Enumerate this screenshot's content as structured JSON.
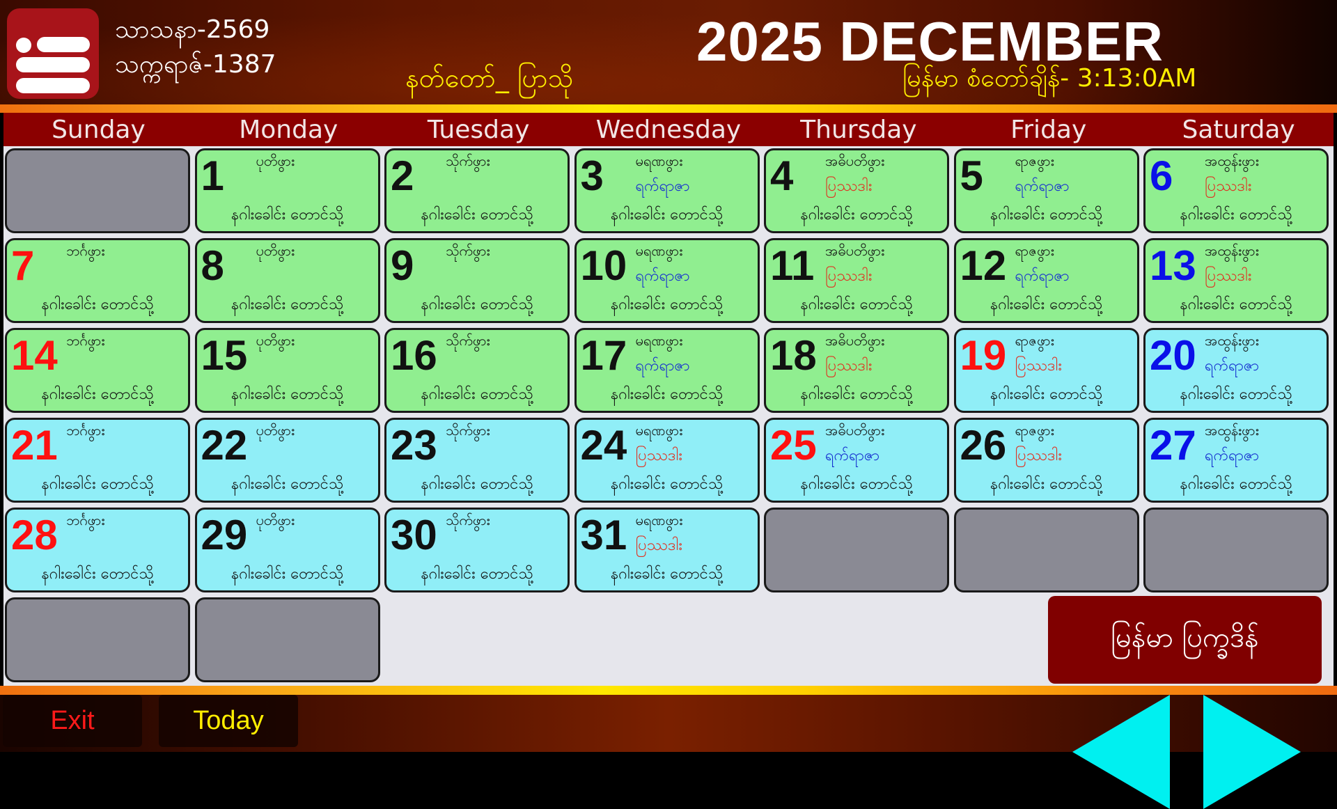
{
  "header": {
    "menu_icon": "menu-list-icon",
    "buddhist_era": "သာသနာ-2569",
    "myanmar_era": "သက္ကရာဇ်-1387",
    "astrological_direction": "နတ်တော်_ ပြာသို",
    "title": "2025 DECEMBER",
    "myanmar_time": "မြန်မာ စံတော်ချိန်- 3:13:0AM"
  },
  "weekdays": [
    "Sunday",
    "Monday",
    "Tuesday",
    "Wednesday",
    "Thursday",
    "Friday",
    "Saturday"
  ],
  "colors": {
    "accent": "#8b0000",
    "cell_green": "#90ee90",
    "cell_cyan": "#90eef7",
    "cell_empty": "#8a8a94",
    "num_black": "#111111",
    "num_red": "#ff1010",
    "num_blue": "#0a10e8",
    "note_blue": "#1530d0",
    "note_red": "#e03020",
    "arrow": "#00f0f0"
  },
  "calendar": {
    "leading_empty": 1,
    "trailing_empty": 5,
    "moon_text": "နဂါးခေါင်း တောင်သို့",
    "days": [
      {
        "day": "1",
        "star": "ပုတိဖွား",
        "note": "",
        "note_color": "",
        "num_color": "black",
        "bg": "green"
      },
      {
        "day": "2",
        "star": "သိုက်ဖွား",
        "note": "",
        "note_color": "",
        "num_color": "black",
        "bg": "green"
      },
      {
        "day": "3",
        "star": "မရဏဖွား",
        "note": "ရက်ရာဇာ",
        "note_color": "blue",
        "num_color": "black",
        "bg": "green"
      },
      {
        "day": "4",
        "star": "အဓိပတိဖွား",
        "note": "ပြဿဒါး",
        "note_color": "red",
        "num_color": "black",
        "bg": "green"
      },
      {
        "day": "5",
        "star": "ရာဇဖွား",
        "note": "ရက်ရာဇာ",
        "note_color": "blue",
        "num_color": "black",
        "bg": "green"
      },
      {
        "day": "6",
        "star": "အထွန်းဖွား",
        "note": "ပြဿဒါး",
        "note_color": "red",
        "num_color": "blue",
        "bg": "green"
      },
      {
        "day": "7",
        "star": "ဘင်္ဂဖွား",
        "note": "",
        "note_color": "",
        "num_color": "red",
        "bg": "green"
      },
      {
        "day": "8",
        "star": "ပုတိဖွား",
        "note": "",
        "note_color": "",
        "num_color": "black",
        "bg": "green"
      },
      {
        "day": "9",
        "star": "သိုက်ဖွား",
        "note": "",
        "note_color": "",
        "num_color": "black",
        "bg": "green"
      },
      {
        "day": "10",
        "star": "မရဏဖွား",
        "note": "ရက်ရာဇာ",
        "note_color": "blue",
        "num_color": "black",
        "bg": "green"
      },
      {
        "day": "11",
        "star": "အဓိပတိဖွား",
        "note": "ပြဿဒါး",
        "note_color": "red",
        "num_color": "black",
        "bg": "green"
      },
      {
        "day": "12",
        "star": "ရာဇဖွား",
        "note": "ရက်ရာဇာ",
        "note_color": "blue",
        "num_color": "black",
        "bg": "green"
      },
      {
        "day": "13",
        "star": "အထွန်းဖွား",
        "note": "ပြဿဒါး",
        "note_color": "red",
        "num_color": "blue",
        "bg": "green"
      },
      {
        "day": "14",
        "star": "ဘင်္ဂဖွား",
        "note": "",
        "note_color": "",
        "num_color": "red",
        "bg": "green"
      },
      {
        "day": "15",
        "star": "ပုတိဖွား",
        "note": "",
        "note_color": "",
        "num_color": "black",
        "bg": "green"
      },
      {
        "day": "16",
        "star": "သိုက်ဖွား",
        "note": "",
        "note_color": "",
        "num_color": "black",
        "bg": "green"
      },
      {
        "day": "17",
        "star": "မရဏဖွား",
        "note": "ရက်ရာဇာ",
        "note_color": "blue",
        "num_color": "black",
        "bg": "green"
      },
      {
        "day": "18",
        "star": "အဓိပတိဖွား",
        "note": "ပြဿဒါး",
        "note_color": "red",
        "num_color": "black",
        "bg": "green"
      },
      {
        "day": "19",
        "star": "ရာဇဖွား",
        "note": "ပြဿဒါး",
        "note_color": "red",
        "num_color": "red",
        "bg": "cyan"
      },
      {
        "day": "20",
        "star": "အထွန်းဖွား",
        "note": "ရက်ရာဇာ",
        "note_color": "blue",
        "num_color": "blue",
        "bg": "cyan"
      },
      {
        "day": "21",
        "star": "ဘင်္ဂဖွား",
        "note": "",
        "note_color": "",
        "num_color": "red",
        "bg": "cyan"
      },
      {
        "day": "22",
        "star": "ပုတိဖွား",
        "note": "",
        "note_color": "",
        "num_color": "black",
        "bg": "cyan"
      },
      {
        "day": "23",
        "star": "သိုက်ဖွား",
        "note": "",
        "note_color": "",
        "num_color": "black",
        "bg": "cyan"
      },
      {
        "day": "24",
        "star": "မရဏဖွား",
        "note": "ပြဿဒါး",
        "note_color": "red",
        "num_color": "black",
        "bg": "cyan"
      },
      {
        "day": "25",
        "star": "အဓိပတိဖွား",
        "note": "ရက်ရာဇာ",
        "note_color": "blue",
        "num_color": "red",
        "bg": "cyan"
      },
      {
        "day": "26",
        "star": "ရာဇဖွား",
        "note": "ပြဿဒါး",
        "note_color": "red",
        "num_color": "black",
        "bg": "cyan"
      },
      {
        "day": "27",
        "star": "အထွန်းဖွား",
        "note": "ရက်ရာဇာ",
        "note_color": "blue",
        "num_color": "blue",
        "bg": "cyan"
      },
      {
        "day": "28",
        "star": "ဘင်္ဂဖွား",
        "note": "",
        "note_color": "",
        "num_color": "red",
        "bg": "cyan"
      },
      {
        "day": "29",
        "star": "ပုတိဖွား",
        "note": "",
        "note_color": "",
        "num_color": "black",
        "bg": "cyan"
      },
      {
        "day": "30",
        "star": "သိုက်ဖွား",
        "note": "",
        "note_color": "",
        "num_color": "black",
        "bg": "cyan"
      },
      {
        "day": "31",
        "star": "မရဏဖွား",
        "note": "ပြဿဒါး",
        "note_color": "red",
        "num_color": "black",
        "bg": "cyan"
      }
    ]
  },
  "buttons": {
    "myanmar_calendar": "မြန်မာ ပြက္ခဒိန်",
    "exit": "Exit",
    "today": "Today",
    "prev_icon": "triangle-left-icon",
    "next_icon": "triangle-right-icon"
  }
}
